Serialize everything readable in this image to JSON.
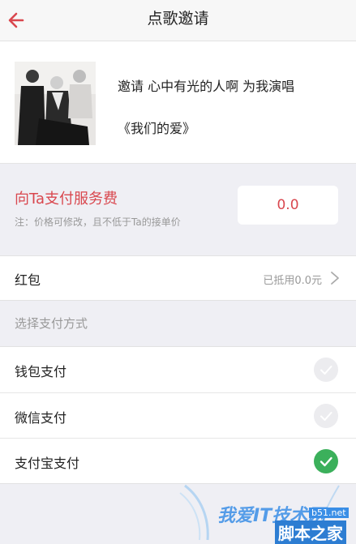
{
  "header": {
    "title": "点歌邀请",
    "back_icon": "back-arrow-icon"
  },
  "invite": {
    "message": "邀请 心中有光的人啊 为我演唱",
    "song": "《我们的爱》"
  },
  "fee": {
    "label": "向Ta支付服务费",
    "note": "注：价格可修改，且不低于Ta的接单价",
    "value": "0.0"
  },
  "red_packet": {
    "label": "红包",
    "value": "已抵用0.0元"
  },
  "payment": {
    "header": "选择支付方式",
    "methods": [
      {
        "label": "钱包支付",
        "selected": false
      },
      {
        "label": "微信支付",
        "selected": false
      },
      {
        "label": "支付宝支付",
        "selected": true
      }
    ]
  },
  "watermark": {
    "text": "我爱IT技术网",
    "site": "b51.net",
    "home": "脚本之家"
  },
  "colors": {
    "accent": "#d9474e",
    "selected": "#3bb05b",
    "background": "#efeff4"
  }
}
